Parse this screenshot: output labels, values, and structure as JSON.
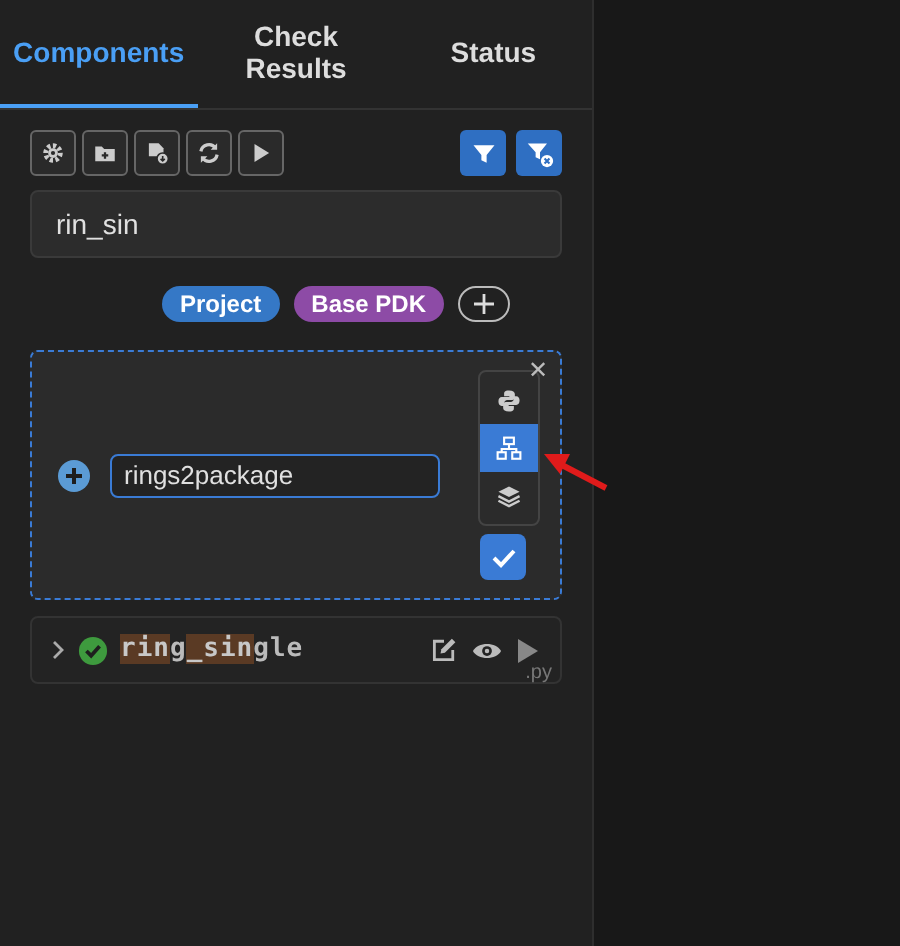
{
  "tabs": [
    {
      "label": "Components",
      "selected": true
    },
    {
      "label": "Check Results",
      "selected": false
    },
    {
      "label": "Status",
      "selected": false
    }
  ],
  "toolbar": {
    "tools": [
      {
        "kind": "settings"
      },
      {
        "kind": "new-folder"
      },
      {
        "kind": "file-download"
      },
      {
        "kind": "refresh"
      },
      {
        "kind": "run"
      }
    ],
    "filters": [
      {
        "kind": "filter",
        "active": true
      },
      {
        "kind": "clear-filter",
        "active": true
      }
    ]
  },
  "search": {
    "value": "rin_sin"
  },
  "sources": [
    {
      "label": "Project",
      "color": "#3578c6"
    },
    {
      "label": "Base PDK",
      "color": "#8d4ba6"
    }
  ],
  "new_component": {
    "close": "✕",
    "name": "rings2package",
    "types": [
      {
        "kind": "python",
        "selected": false
      },
      {
        "kind": "hierarchy",
        "selected": true
      },
      {
        "kind": "layers",
        "selected": false
      }
    ]
  },
  "components": [
    {
      "name": [
        {
          "text": "rin",
          "match": true
        },
        {
          "text": "g",
          "match": false
        },
        {
          "text": "_sin",
          "match": true
        },
        {
          "text": "gle",
          "match": false
        }
      ],
      "expanded": false,
      "extension": ".py"
    }
  ]
}
